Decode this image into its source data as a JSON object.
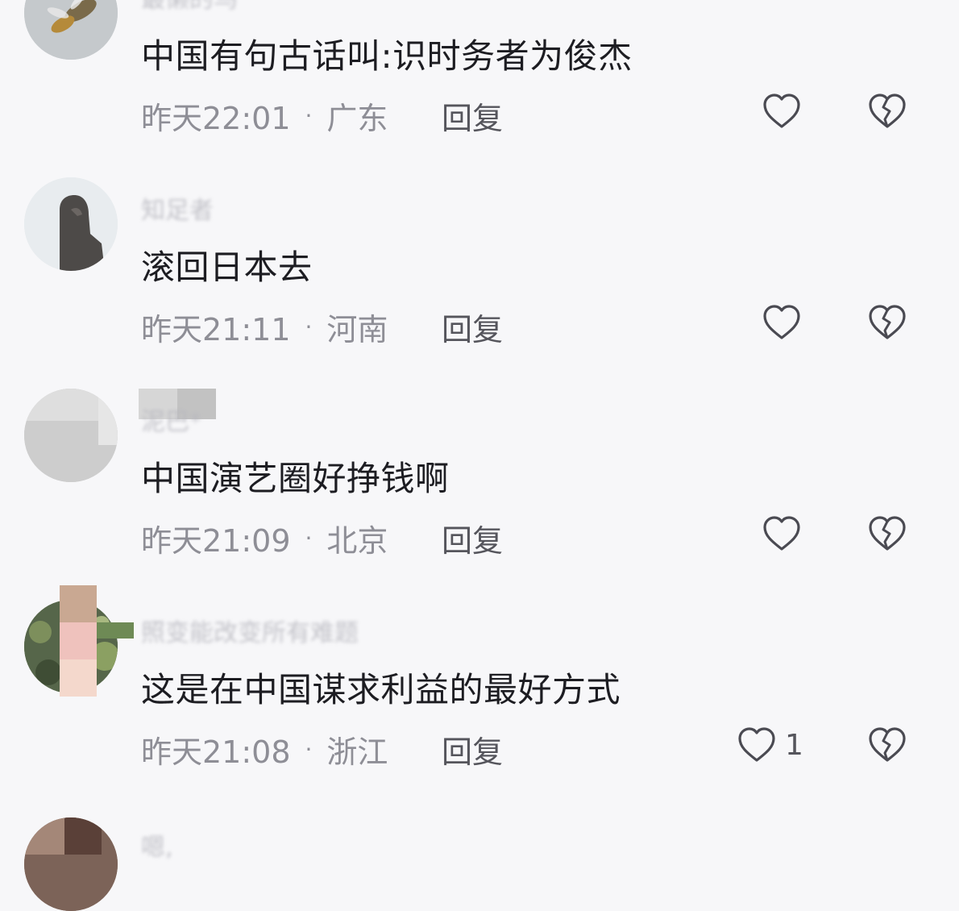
{
  "comments": [
    {
      "username": "最懒的鸟",
      "text": "中国有句古话叫:识时务者为俊杰",
      "time": "昨天22:01",
      "separator": "·",
      "location": "广东",
      "reply_label": "回复",
      "like_count": ""
    },
    {
      "username": "知足者",
      "text": "滚回日本去",
      "time": "昨天21:11",
      "separator": "·",
      "location": "河南",
      "reply_label": "回复",
      "like_count": ""
    },
    {
      "username": "泥巴*",
      "text": "中国演艺圈好挣钱啊",
      "time": "昨天21:09",
      "separator": "·",
      "location": "北京",
      "reply_label": "回复",
      "like_count": ""
    },
    {
      "username": "照变能改变所有难题",
      "text": "这是在中国谋求利益的最好方式",
      "time": "昨天21:08",
      "separator": "·",
      "location": "浙江",
      "reply_label": "回复",
      "like_count": "1"
    },
    {
      "username": "嗯,",
      "text": "",
      "time": "",
      "separator": "",
      "location": "",
      "reply_label": "",
      "like_count": ""
    }
  ],
  "icons": {
    "like": "heart-outline-icon",
    "dislike": "broken-heart-icon"
  },
  "colors": {
    "background": "#f7f7f9",
    "comment_text": "#1d1d22",
    "meta_text": "#8e8e96",
    "icon_stroke": "#4a4a52"
  }
}
